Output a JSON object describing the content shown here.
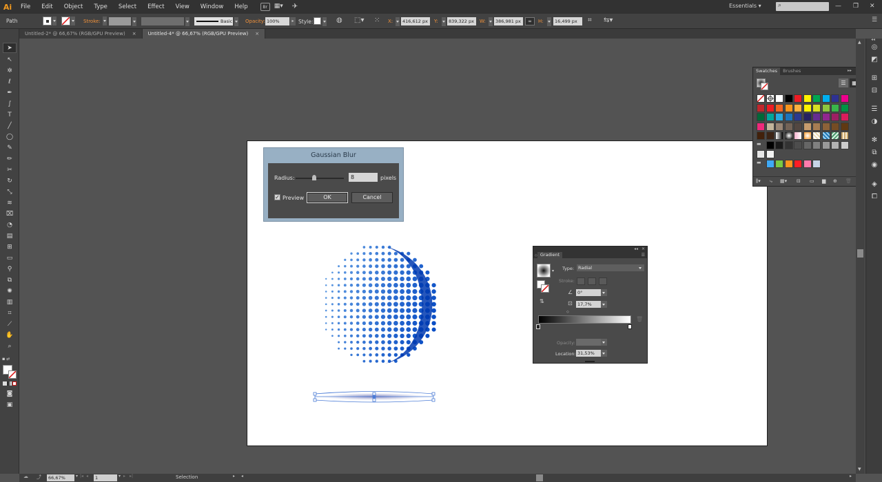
{
  "app": {
    "logo": "Ai"
  },
  "menu": [
    "File",
    "Edit",
    "Object",
    "Type",
    "Select",
    "Effect",
    "View",
    "Window",
    "Help"
  ],
  "menubar": {
    "bridge": "Br",
    "workspace": "Essentials"
  },
  "control": {
    "object_type": "Path",
    "stroke_label": "Stroke:",
    "brush_label": "Basic",
    "opacity_label": "Opacity:",
    "opacity_value": "100%",
    "style_label": "Style:",
    "x_label": "X:",
    "x_value": "416,612 px",
    "y_label": "Y:",
    "y_value": "839,322 px",
    "w_label": "W:",
    "w_value": "386,981 px",
    "h_label": "H:",
    "h_value": "16,499 px"
  },
  "tabs": [
    {
      "label": "Untitled-2* @ 66,67% (RGB/GPU Preview)",
      "close": "×"
    },
    {
      "label": "Untitled-4* @ 66,67% (RGB/GPU Preview)",
      "close": "×"
    }
  ],
  "gaussian_blur": {
    "title": "Gaussian Blur",
    "radius_label": "Radius:",
    "radius_value": "8",
    "units": "pixels",
    "preview_label": "Preview",
    "preview_checked": "✓",
    "ok_label": "OK",
    "cancel_label": "Cancel"
  },
  "swatches": {
    "tab_active": "Swatches",
    "tab_other": "Brushes",
    "rows": [
      [
        "none",
        "reg",
        "#ffffff",
        "#000000",
        "#ed1c24",
        "#fff200",
        "#00a651",
        "#00aeef",
        "#2e3192",
        "#ec008c"
      ],
      [
        "#c1272d",
        "#ed1c24",
        "#f26522",
        "#f7941d",
        "#fbb040",
        "#fff200",
        "#d7df23",
        "#8dc63f",
        "#39b54a",
        "#009444"
      ],
      [
        "#006838",
        "#00a79d",
        "#27aae1",
        "#1c75bc",
        "#2b3990",
        "#262262",
        "#662d91",
        "#92278f",
        "#9e1f63",
        "#da1c5c"
      ],
      [
        "#ee2a7b",
        "#c2b59b",
        "#998675",
        "#736357",
        "#534741",
        "#c69c6d",
        "#a67c52",
        "#8c6239",
        "#754c24",
        "#603913"
      ],
      [
        "#42210b",
        "#3c2415",
        "grad1",
        "grad2",
        "grad3",
        "grad4",
        "pat1",
        "pat2",
        "pat3",
        "pat4"
      ],
      [
        "folder",
        "#000000",
        "#1a1a1a",
        "#333333",
        "#4d4d4d",
        "#666666",
        "#808080",
        "#999999",
        "#b3b3b3",
        "#cccccc"
      ],
      [
        "#e6e6e6",
        "#f2f2f2"
      ],
      [
        "folder",
        "#3fa9f5",
        "#7ac943",
        "#ff931e",
        "#ff1d25",
        "#ff7bac",
        "#c7d4e6"
      ]
    ]
  },
  "gradient": {
    "title": "Gradient",
    "type_label": "Type:",
    "type_value": "Radial",
    "stroke_label": "Stroke:",
    "angle_value": "0°",
    "aspect_value": "17,7%",
    "opacity_label": "Opacity:",
    "location_label": "Location:",
    "location_value": "31,53%"
  },
  "status": {
    "zoom": "66,67%",
    "page": "1",
    "tool": "Selection"
  },
  "sphere": {
    "colors": {
      "light": "#6aa5e6",
      "dark": "#0a4ec5",
      "rim": "#003ab0"
    }
  }
}
